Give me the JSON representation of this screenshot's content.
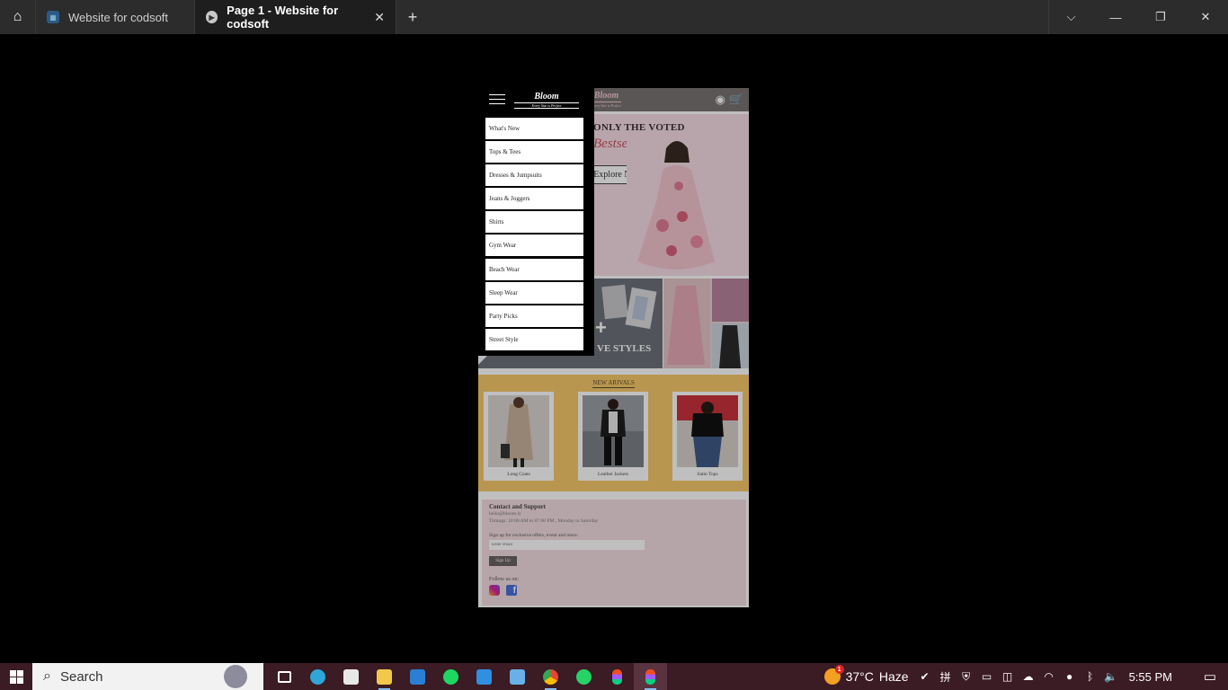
{
  "browser": {
    "tabs": [
      {
        "label": "Website for codsoft"
      },
      {
        "label": "Page 1 - Website for codsoft"
      }
    ],
    "close_glyph": "✕",
    "new_tab_glyph": "+",
    "controls": {
      "dropdown": "⌵",
      "minimize": "—",
      "maximize": "❐",
      "close": "✕"
    }
  },
  "site": {
    "logo": "Bloom",
    "tagline": "Every Size is Perfect",
    "hero_title": "ONLY THE VOTED",
    "hero_script": "Bestsellers",
    "hero_button": "Explore Now",
    "styles_text": "VE STYLES",
    "arrivals_title": "NEW ARIVALS",
    "arrivals": [
      {
        "caption": "Long Coats"
      },
      {
        "caption": "Leather Jackets"
      },
      {
        "caption": "Satin Tops"
      }
    ],
    "footer": {
      "heading": "Contact and Support",
      "email": "hello@bloom.ly",
      "timings": "Timings: 10:00 AM to 07:00 PM , Monday to Saturday",
      "signup_text": "Sign up for exclusive offers, event and more.",
      "email_placeholder": "Enter email",
      "signup_button": "Sign Up",
      "follow": "Follow us on:"
    }
  },
  "menu": {
    "logo": "Bloom",
    "tagline": "Every Size is Perfect",
    "items": [
      "What's New",
      "Tops & Tees",
      "Dresses & Jumpsuits",
      "Jeans & Joggers",
      "Shirts",
      "Gym Wear",
      "Beach Wear",
      "Sleep Wear",
      "Party Picks",
      "Street Style"
    ]
  },
  "taskbar": {
    "search": "Search",
    "weather_temp": "37°C",
    "weather_text": "Haze",
    "weather_badge": "1",
    "time": "5:55 PM"
  }
}
